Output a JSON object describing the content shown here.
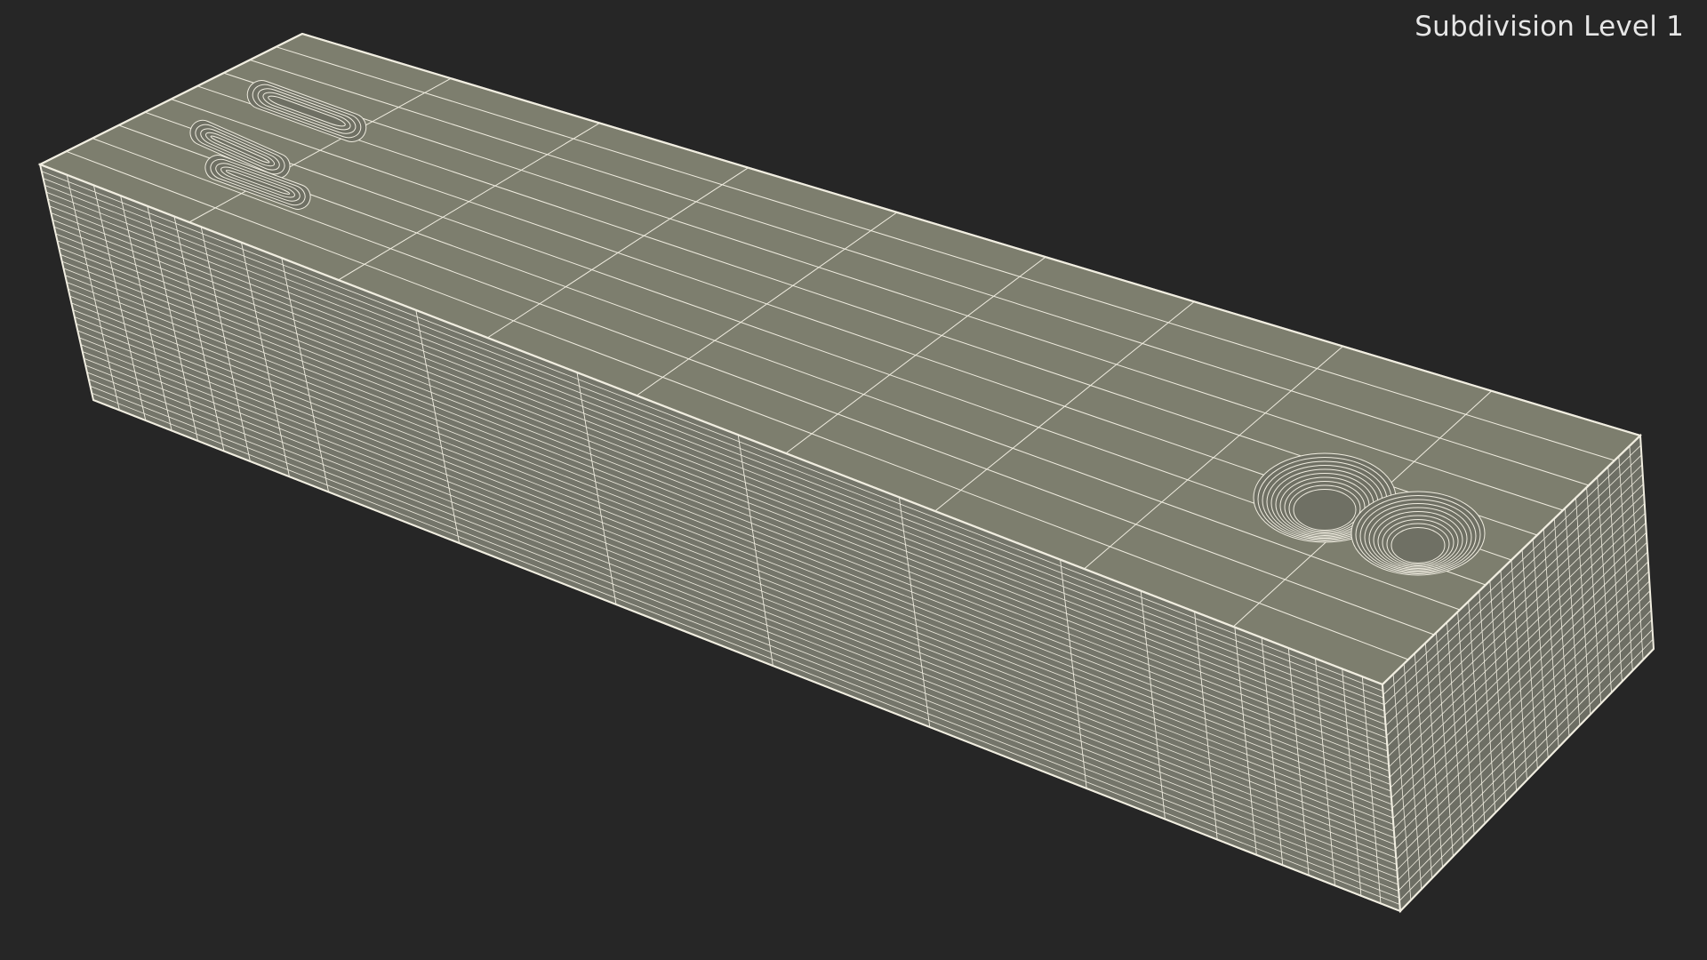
{
  "viewport": {
    "label": "Subdivision Level 1",
    "background_color": "#262626"
  },
  "model": {
    "fill_top": "#7d7e6e",
    "fill_front": "#74756a",
    "fill_side": "#6d6e64",
    "wire_color": "#f0ede0"
  }
}
